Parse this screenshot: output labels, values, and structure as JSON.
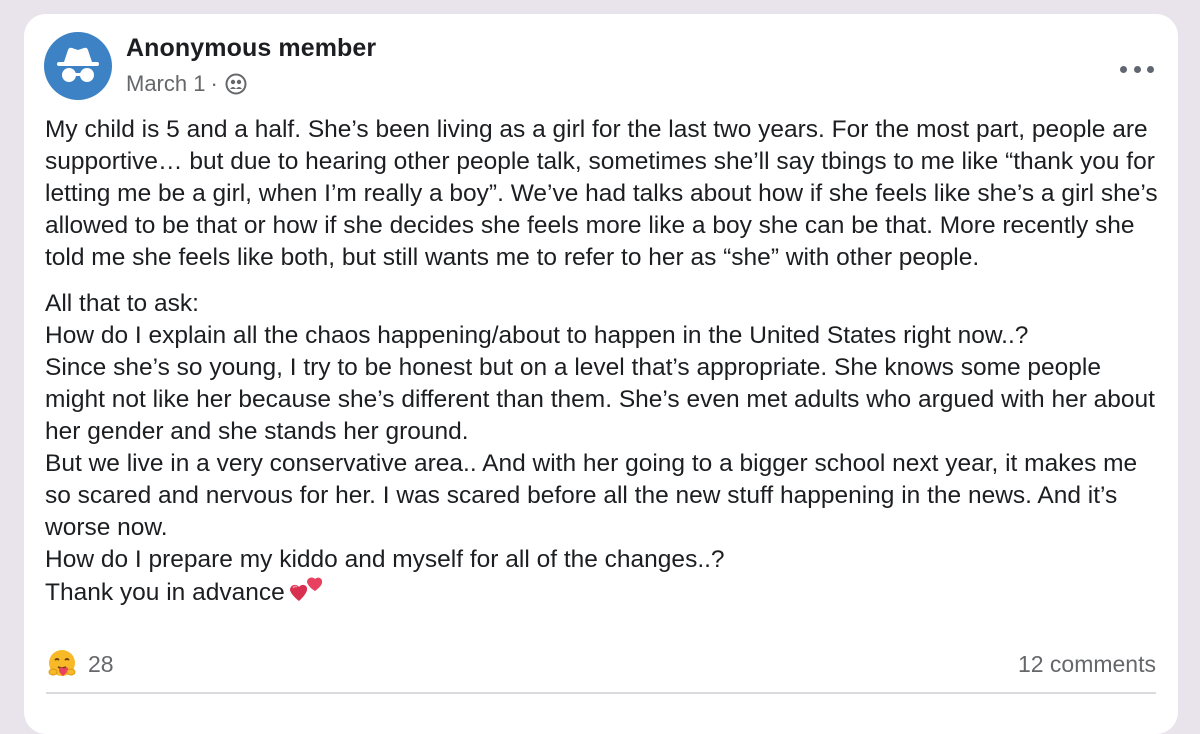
{
  "post": {
    "author": "Anonymous member",
    "date": "March 1",
    "separator": "·",
    "avatar_icon": "incognito-icon",
    "privacy_icon": "group-privacy-icon",
    "more_icon": "more-options-icon",
    "paragraphs": [
      "My child is 5 and a half. She’s been living as a girl for the last two years. For the most part, people are supportive… but due to hearing other people talk, sometimes she’ll say tbings to me like “thank you for letting me be a girl, when I’m really a boy”.  We’ve had talks about how if she feels like she’s a girl she’s allowed to be that or how if she decides she feels more like a boy she can be that. More recently she told me she feels like both, but still wants me to refer to her as “she” with other people.",
      "All that to ask:",
      "How do I explain all the chaos happening/about to happen in the United States right now..?",
      "Since she’s so young, I try to be honest but on a level that’s appropriate. She knows some people might not like her because she’s different than them. She’s even met adults who argued with her about her gender and she stands her ground.",
      "But we live in a very conservative area.. And with her going to a bigger school next year, it makes me so scared and nervous for her. I was scared before all the new stuff happening in the news. And it’s worse now.",
      "How do I prepare my kiddo and myself for all of the changes..?",
      "Thank you in advance"
    ],
    "closing_emoji": "heart-icon"
  },
  "footer": {
    "reaction_icon": "care-reaction-icon",
    "reaction_count": "28",
    "comments": "12 comments"
  },
  "colors": {
    "background": "#e9e4ec",
    "card": "#ffffff",
    "avatar": "#3d82c4",
    "text": "#1c1e21",
    "secondary_text": "#65676b"
  }
}
